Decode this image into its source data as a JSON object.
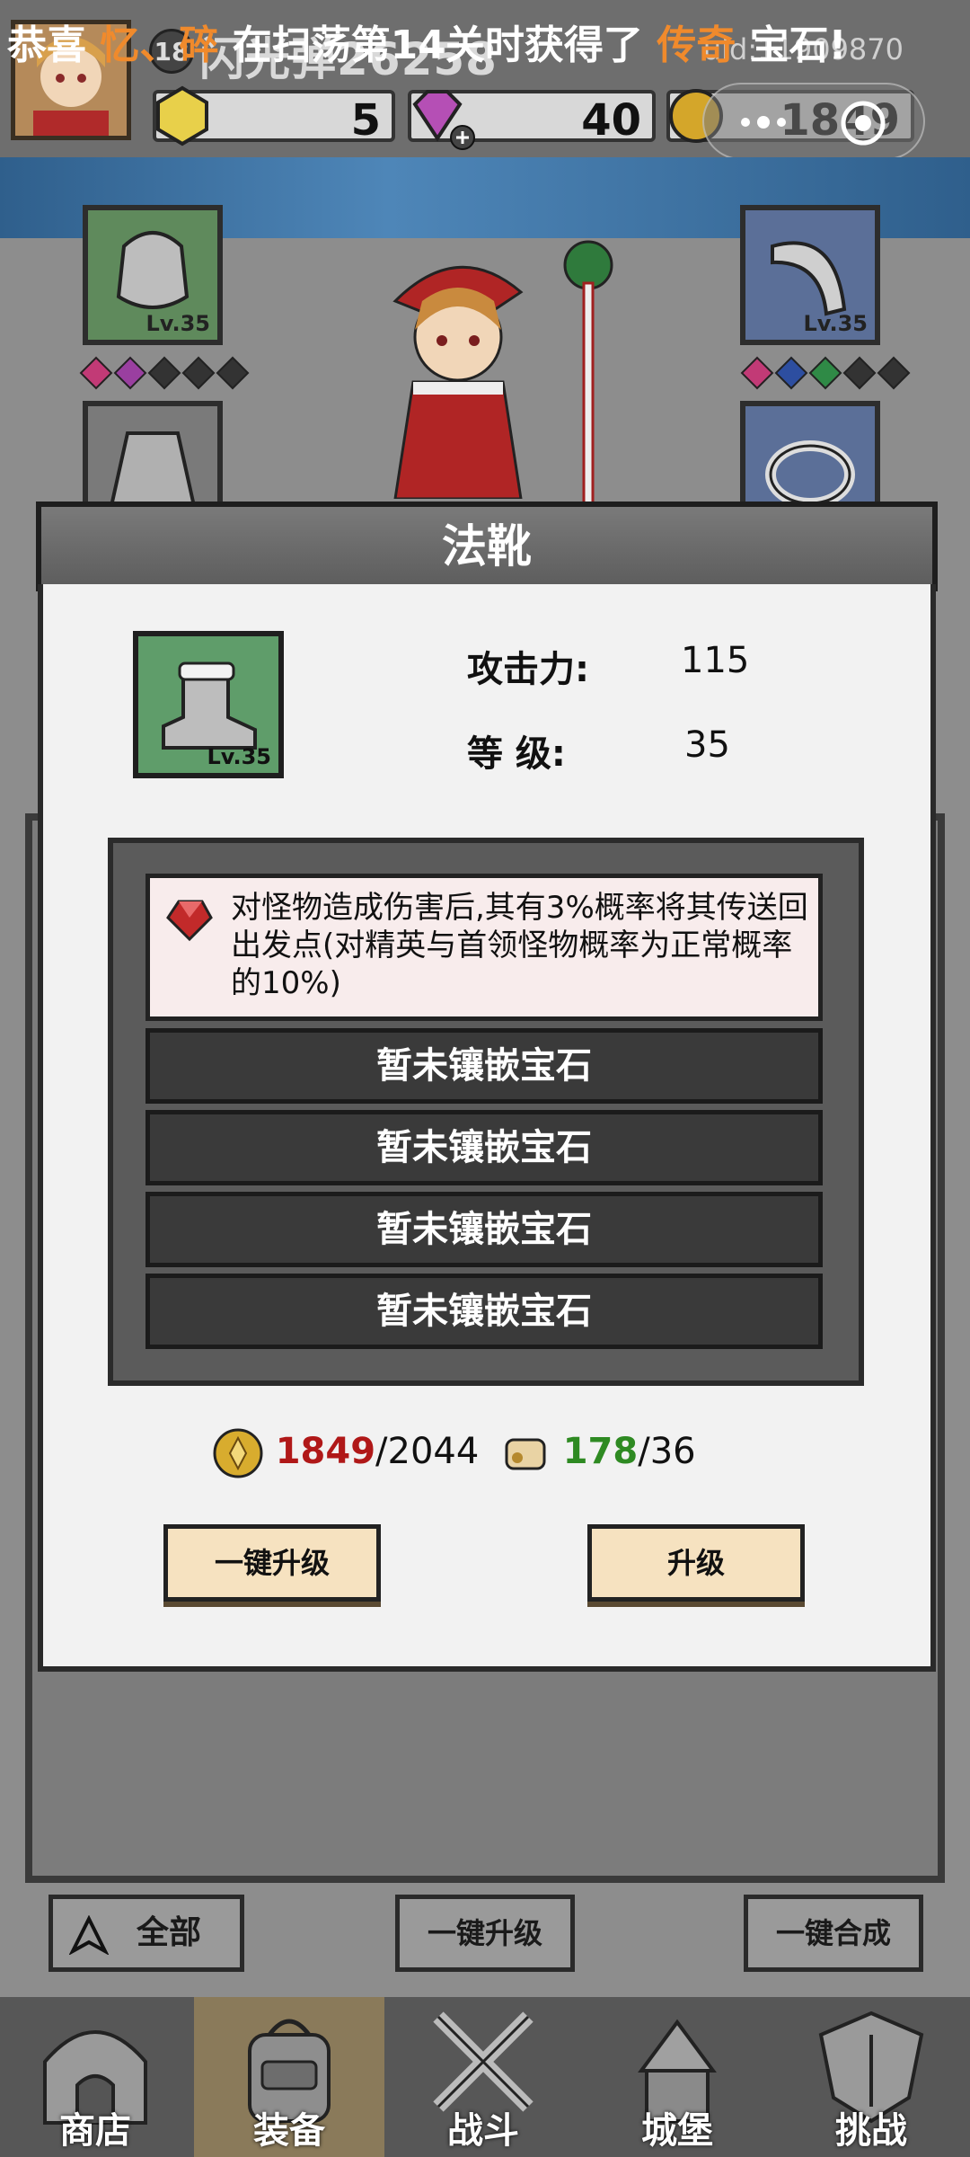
{
  "header": {
    "level": "18",
    "player_name": "闪光弹26258",
    "uid": "uid:11909870",
    "gold_count": "5",
    "diamond_count": "40",
    "coin_count": "1849"
  },
  "banner": {
    "prefix": "恭喜 ",
    "player": "忆、碎",
    "middle": " 在扫荡第14关时获得了 ",
    "rarity": "传奇",
    "suffix": " 宝石!"
  },
  "equipment_slots": {
    "top_left_level": "Lv.35",
    "top_right_level": "Lv.35"
  },
  "modal": {
    "title": "法靴",
    "item_level": "Lv.35",
    "attack_label": "攻击力:",
    "attack_value": "115",
    "level_label": "等 级:",
    "level_value": "35",
    "gem_effect": "对怪物造成伤害后,其有3%概率将其传送回出发点(对精英与首领怪物概率为正常概率的10%)",
    "empty_sockets": [
      "暂未镶嵌宝石",
      "暂未镶嵌宝石",
      "暂未镶嵌宝石",
      "暂未镶嵌宝石"
    ],
    "coin_have": "1849",
    "coin_need": "/2044",
    "scroll_have": "178",
    "scroll_need": "/36",
    "btn_upgrade_all": "一键升级",
    "btn_upgrade": "升级"
  },
  "actions": {
    "filter_label": "全部",
    "upgrade_all": "一键升级",
    "merge_all": "一键合成"
  },
  "nav": [
    {
      "label": "商店"
    },
    {
      "label": "装备"
    },
    {
      "label": "战斗"
    },
    {
      "label": "城堡"
    },
    {
      "label": "挑战"
    }
  ],
  "colors": {
    "banner_highlight": "#f08a2c",
    "coin_have": "#b01818",
    "scroll_have": "#2e8a22",
    "modal_button_bg": "#f6e2c0"
  }
}
